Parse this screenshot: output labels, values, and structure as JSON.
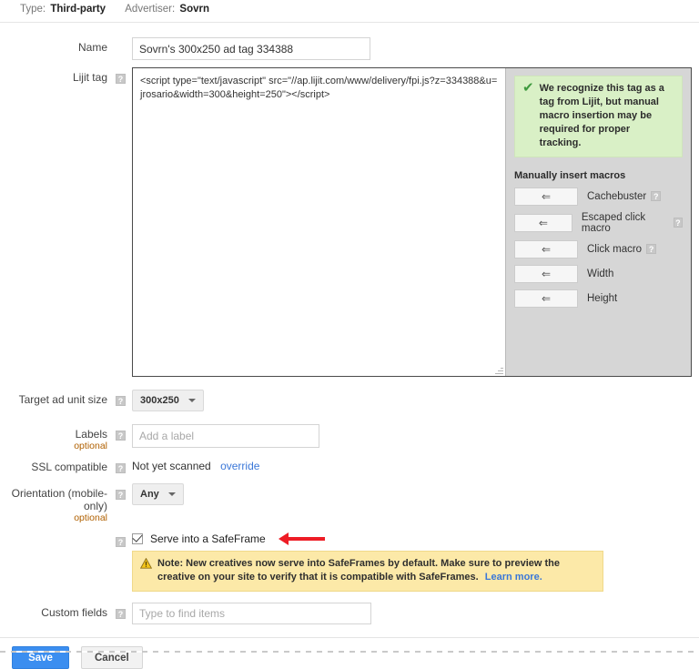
{
  "header": {
    "type_label": "Type:",
    "type_value": "Third-party",
    "advertiser_label": "Advertiser:",
    "advertiser_value": "Sovrn"
  },
  "form": {
    "name": {
      "label": "Name",
      "value": "Sovrn's 300x250 ad tag 334388"
    },
    "lijit_tag": {
      "label": "Lijit tag",
      "value": "<script type=\"text/javascript\" src=\"//ap.lijit.com/www/delivery/fpi.js?z=334388&u=jrosario&width=300&height=250\"></script>",
      "recognize_notice": "We recognize this tag as a tag from Lijit, but manual macro insertion may be required for proper tracking.",
      "macros_title": "Manually insert macros",
      "macros": [
        {
          "name": "Cachebuster",
          "arrow": "left-arrow-icon",
          "has_help": true
        },
        {
          "name": "Escaped click macro",
          "arrow": "left-arrow-icon",
          "has_help": true
        },
        {
          "name": "Click macro",
          "arrow": "left-arrow-icon",
          "has_help": true
        },
        {
          "name": "Width",
          "arrow": "left-arrow-icon",
          "has_help": false
        },
        {
          "name": "Height",
          "arrow": "left-arrow-icon",
          "has_help": false
        }
      ]
    },
    "target_ad_unit_size": {
      "label": "Target ad unit size",
      "value": "300x250"
    },
    "labels": {
      "label": "Labels",
      "optional": "optional",
      "placeholder": "Add a label"
    },
    "ssl_compatible": {
      "label": "SSL compatible",
      "status": "Not yet scanned",
      "override_link": "override"
    },
    "orientation": {
      "label": "Orientation (mobile-only)",
      "optional": "optional",
      "value": "Any"
    },
    "safeframe": {
      "checkbox_label": "Serve into a SafeFrame",
      "checked": true,
      "note": "Note: New creatives now serve into SafeFrames by default. Make sure to preview the creative on your site to verify that it is compatible with SafeFrames.",
      "note_link": "Learn more."
    },
    "custom_fields": {
      "label": "Custom fields",
      "placeholder": "Type to find items"
    }
  },
  "footer": {
    "save_label": "Save",
    "cancel_label": "Cancel"
  },
  "colors": {
    "primary_button": "#3b8ef0",
    "link": "#3a77d8",
    "success_box": "#d9f0c6",
    "warning_box": "#fce9a8",
    "annotation_arrow": "#ee1c25",
    "optional_text": "#b06000"
  },
  "glyphs": {
    "help": "?",
    "check": "✔",
    "warning": "⚠",
    "left_arrow": "⇐"
  }
}
